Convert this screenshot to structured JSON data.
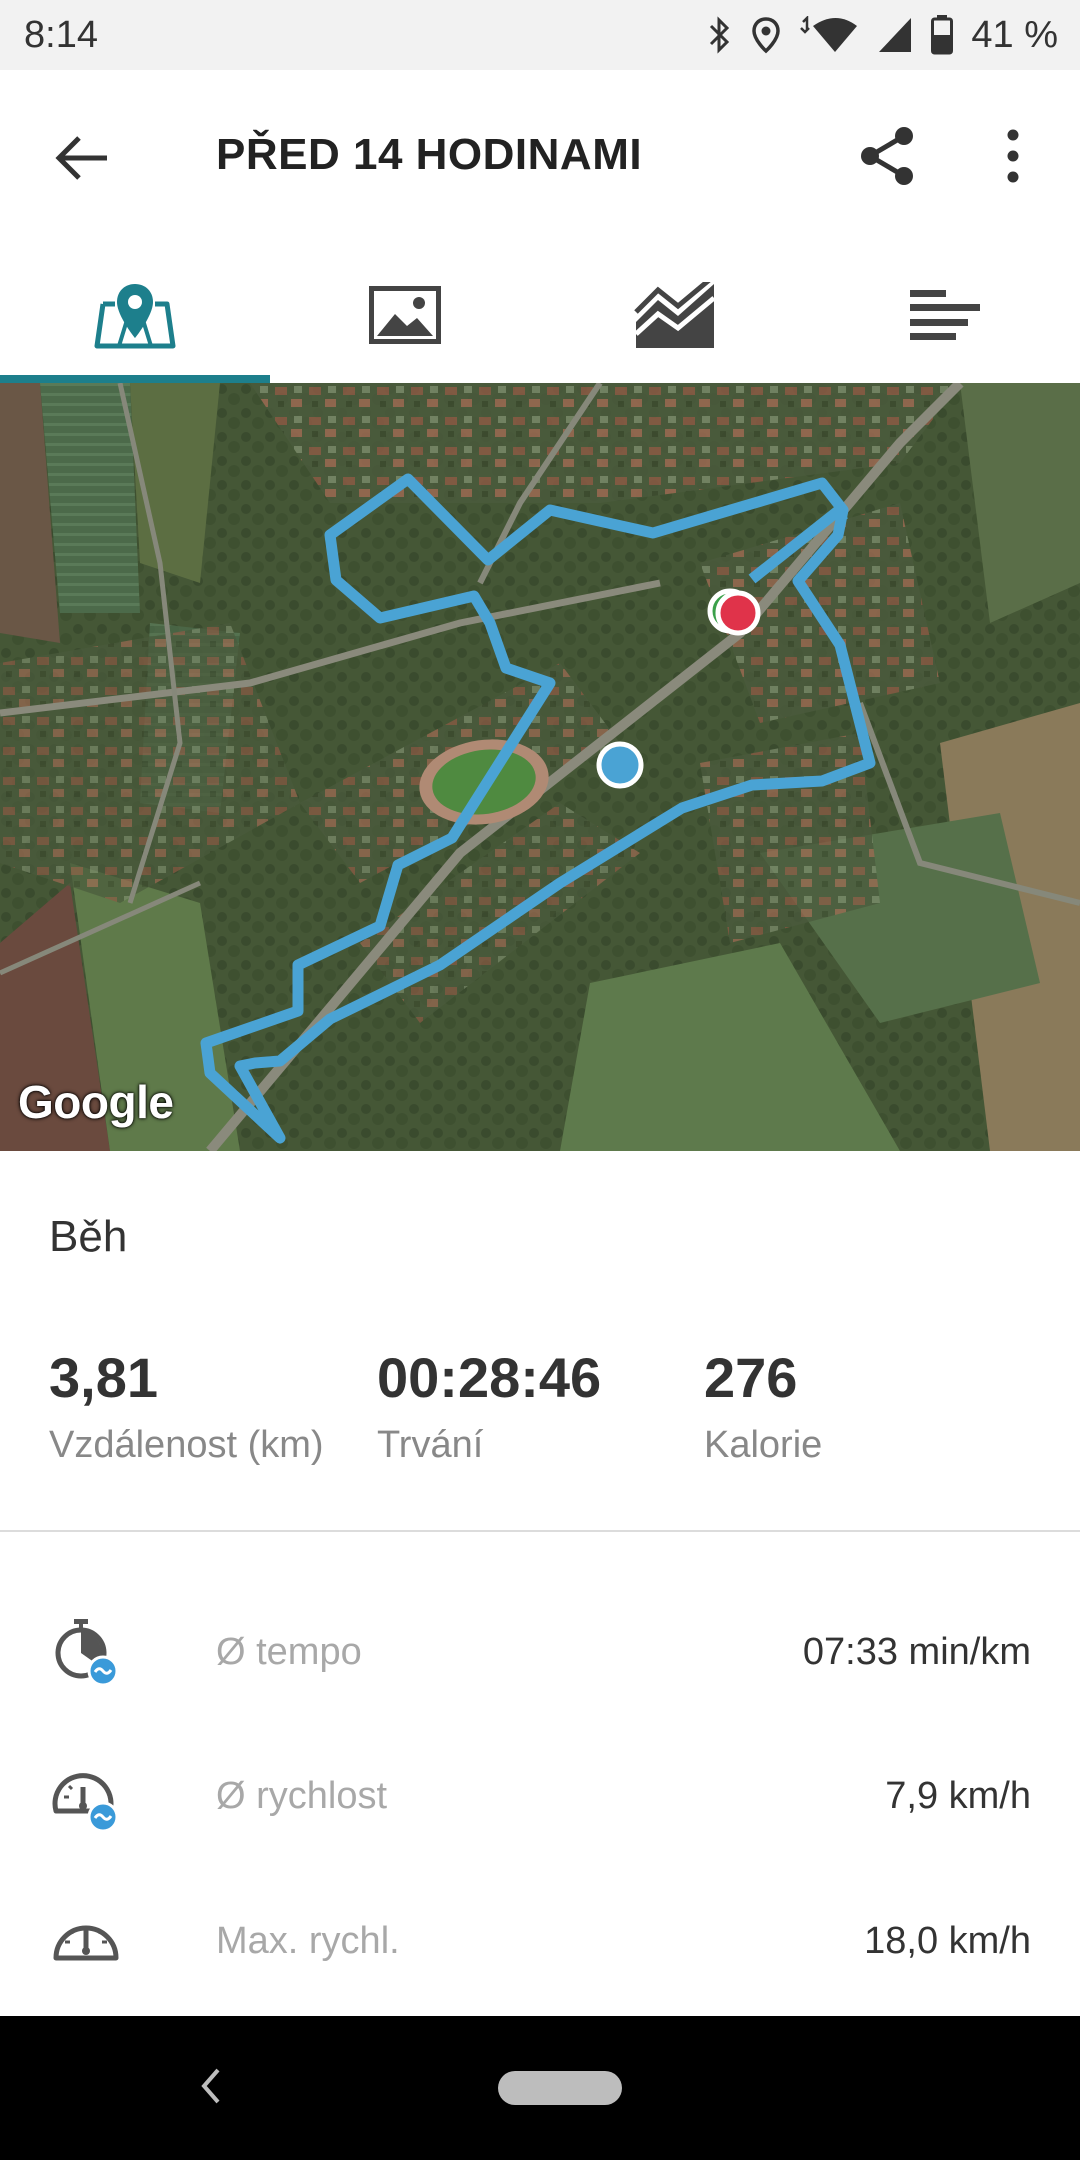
{
  "status_bar": {
    "time": "8:14",
    "battery": "41 %",
    "icons": [
      "bluetooth-icon",
      "location-icon",
      "wifi-icon",
      "signal-icon",
      "battery-icon"
    ]
  },
  "app_bar": {
    "title": "PŘED 14 HODINAMI",
    "back_icon": "arrow-back-icon",
    "share_icon": "share-icon",
    "more_icon": "more-vert-icon"
  },
  "tabs": [
    {
      "icon": "map-pin-icon",
      "active": true
    },
    {
      "icon": "image-icon",
      "active": false
    },
    {
      "icon": "chart-icon",
      "active": false
    },
    {
      "icon": "list-icon",
      "active": false
    }
  ],
  "map": {
    "attribution": "Google",
    "route_color": "#4aa3d4",
    "start_color": "#4aa3d4",
    "end_color": "#e0334a"
  },
  "activity": {
    "type": "Běh"
  },
  "summary": {
    "distance": {
      "value": "3,81",
      "label": "Vzdálenost (km)"
    },
    "duration": {
      "value": "00:28:46",
      "label": "Trvání"
    },
    "calories": {
      "value": "276",
      "label": "Kalorie"
    }
  },
  "details": [
    {
      "icon": "pace-icon",
      "label": "Ø tempo",
      "value": "07:33 min/km"
    },
    {
      "icon": "avg-speed-icon",
      "label": "Ø rychlost",
      "value": "7,9 km/h"
    },
    {
      "icon": "max-speed-icon",
      "label": "Max. rychl.",
      "value": "18,0 km/h"
    }
  ],
  "colors": {
    "accent": "#1d7f8c",
    "badge": "#3a9ad9"
  }
}
